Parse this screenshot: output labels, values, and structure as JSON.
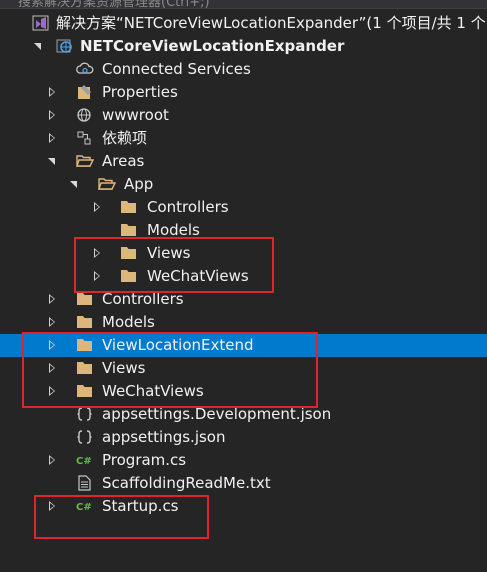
{
  "search": {
    "placeholder": "搜索解决方案资源管理器(Ctrl+;)"
  },
  "solution": {
    "label": "解决方案“NETCoreViewLocationExpander”(1 个项目/共 1 个)"
  },
  "project": {
    "label": "NETCoreViewLocationExpander"
  },
  "items": {
    "connected_services": "Connected Services",
    "properties": "Properties",
    "wwwroot": "wwwroot",
    "dependencies": "依赖项",
    "areas": "Areas",
    "app": "App",
    "app_controllers": "Controllers",
    "app_models": "Models",
    "app_views": "Views",
    "app_wechatviews": "WeChatViews",
    "controllers": "Controllers",
    "models": "Models",
    "viewlocationextend": "ViewLocationExtend",
    "views": "Views",
    "wechatviews": "WeChatViews",
    "appsettings_dev": "appsettings.Development.json",
    "appsettings": "appsettings.json",
    "program": "Program.cs",
    "scaffolding": "ScaffoldingReadMe.txt",
    "startup": "Startup.cs"
  },
  "colors": {
    "background": "#252526",
    "selection": "#007acc",
    "highlight_box": "#e0242b",
    "folder": "#dcb67a",
    "csharp": "#68b848"
  },
  "icons": {
    "solution": "visual-studio-solution-icon",
    "project": "web-project-icon",
    "connected_services": "cloud-link-icon",
    "properties": "wrench-properties-icon",
    "wwwroot": "globe-icon",
    "dependencies": "dependencies-icon",
    "folder": "folder-icon",
    "folder_open": "folder-open-icon",
    "json": "json-file-icon",
    "csharp": "csharp-file-icon",
    "text": "text-file-icon"
  }
}
